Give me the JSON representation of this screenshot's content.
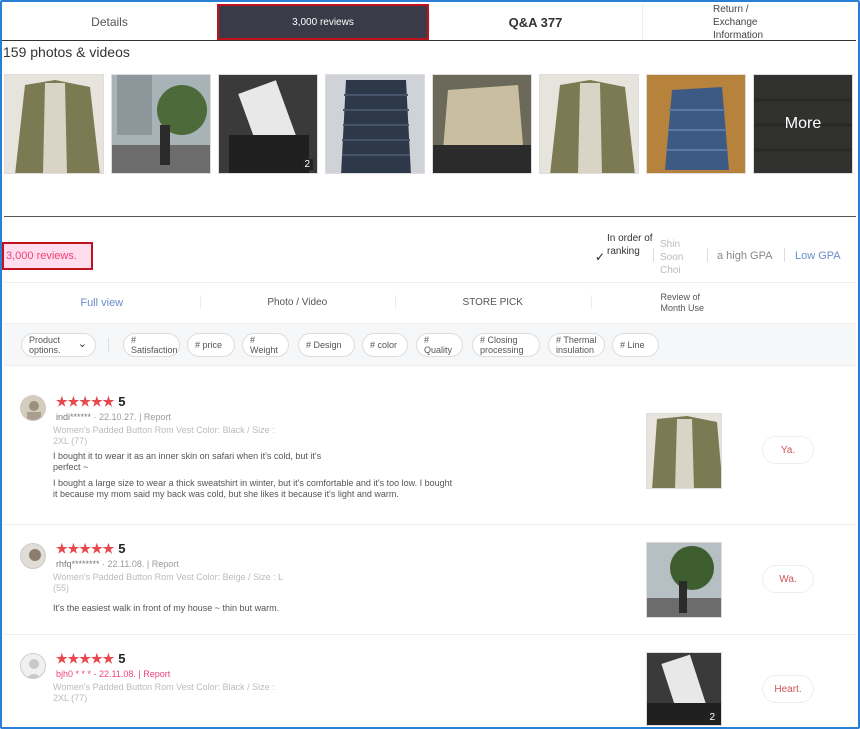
{
  "tabs": {
    "details": "Details",
    "reviews": "3,000 reviews",
    "qa": "Q&A 377",
    "return": "Return / Exchange Information"
  },
  "photos": {
    "title": "159 photos & videos",
    "second_count": "2",
    "more_label": "More"
  },
  "review_header": {
    "count": "3,000 reviews.",
    "sort_ranking": "In order of ranking",
    "sort_shin": "Shin Soon Choi",
    "sort_high": "a high GPA",
    "sort_low": "Low GPA"
  },
  "subtabs": {
    "full": "Full view",
    "photo": "Photo / Video",
    "store": "STORE PICK",
    "month": "Review of Month Use"
  },
  "filters": {
    "product_options": "Product options.",
    "chips": [
      "# Satisfaction",
      "# price",
      "# Weight",
      "# Design",
      "# color",
      "# Quality",
      "# Closing processing",
      "# Thermal insulation",
      "# Line"
    ]
  },
  "reviews": [
    {
      "stars": "★★★★★",
      "score": "5",
      "user": "indi******",
      "date_report": " · 22.10.27. | Report",
      "option": "Women's Padded Button Rom Vest Color: Black / Size : 2XL (77)",
      "text1": "I bought it to wear it as an inner skin on safari when it's cold, but it's perfect ~",
      "text2": "I bought a large size to wear a thick sweatshirt in winter, but it's comfortable and it's too low. I bought it because my mom said my back was cold, but she likes it because it's light and warm.",
      "button": "Ya."
    },
    {
      "stars": "★★★★★",
      "score": "5",
      "user": "rhfq********",
      "date_report": " · 22.11.08. | Report",
      "option": "Women's Padded Button Rom Vest Color: Beige / Size : L (55)",
      "text1": "It's the easiest walk in front of my house ~ thin but warm.",
      "button": "Wa."
    },
    {
      "stars": "★★★★★",
      "score": "5",
      "user": "bjh0 * * * - 22.11.08. | Report",
      "option": "Women's Padded Button Rom Vest Color: Black / Size : 2XL (77)",
      "img_count": "2",
      "button": "Heart."
    }
  ],
  "colors": {
    "accent_red": "#c0141c",
    "star": "#e5484d",
    "link_blue": "#6a8ccc",
    "frame_blue": "#2a7fd4"
  }
}
